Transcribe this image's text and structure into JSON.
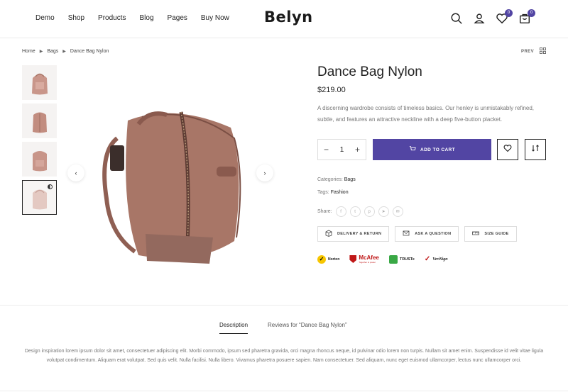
{
  "header": {
    "nav": [
      "Demo",
      "Shop",
      "Products",
      "Blog",
      "Pages",
      "Buy Now"
    ],
    "logo": "Belyn",
    "wishlist_count": "0",
    "cart_count": "0",
    "accent": "#5245a3"
  },
  "breadcrumb": [
    "Home",
    "Bags",
    "Dance Bag Nylon"
  ],
  "pager": {
    "prev": "PREV"
  },
  "product": {
    "title": "Dance Bag Nylon",
    "price": "$219.00",
    "description": "A discerning wardrobe consists of timeless basics. Our henley is unmistakably refined, subtle, and features an attractive neckline with a deep five-button placket.",
    "quantity": "1",
    "add_to_cart": "ADD TO CART",
    "categories_label": "Categories:",
    "categories_value": "Bags",
    "tags_label": "Tags:",
    "tags_value": "Fashion",
    "share_label": "Share:",
    "share_icons": [
      "facebook-icon",
      "twitter-icon",
      "pinterest-icon",
      "telegram-icon",
      "email-icon"
    ],
    "info_buttons": [
      "DELIVERY & RETURN",
      "ASK A QUESTION",
      "SIZE GUIDE"
    ],
    "trust_badges": [
      "Norton",
      "McAfee",
      "TRUSTe",
      "VeriSign"
    ],
    "mcafee_sub": "Together is power"
  },
  "tabs": {
    "items": [
      "Description",
      "Reviews for “Dance Bag Nylon”"
    ],
    "active": "Description",
    "content": "Design inspiration lorem ipsum dolor sit amet, consectetuer adipiscing elit. Morbi commodo, ipsum sed pharetra gravida, orci magna rhoncus neque, id pulvinar odio lorem non turpis. Nullam sit amet enim. Suspendisse id velit vitae ligula volutpat condimentum. Aliquam erat volutpat. Sed quis velit. Nulla facilisi. Nulla libero. Vivamus pharetra posuere sapien. Nam consectetuer. Sed aliquam, nunc eget euismod ullamcorper, lectus nunc ullamcorper orci."
  }
}
